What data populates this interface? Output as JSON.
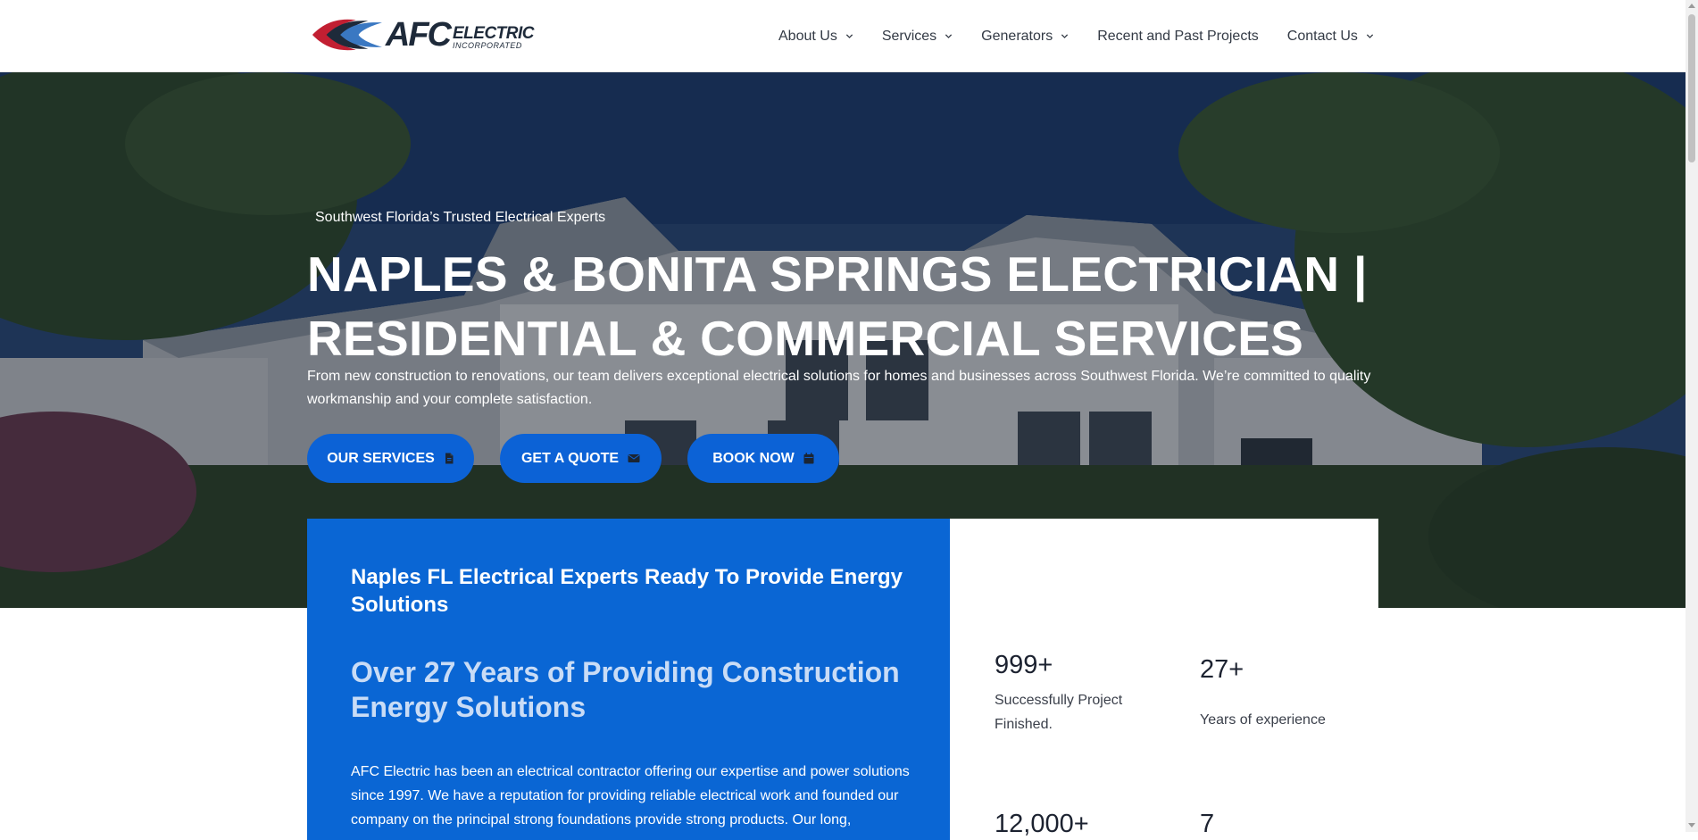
{
  "header": {
    "logo": {
      "brand": "AFC",
      "line1": "ELECTRIC",
      "line2": "INCORPORATED",
      "icon": "afc-swoosh-logo-icon",
      "colors": [
        "#c21f32",
        "#3a78c2",
        "#1e2a3a"
      ]
    },
    "nav": [
      {
        "label": "About Us",
        "has_dropdown": true
      },
      {
        "label": "Services",
        "has_dropdown": true
      },
      {
        "label": "Generators",
        "has_dropdown": true
      },
      {
        "label": "Recent and Past Projects",
        "has_dropdown": false
      },
      {
        "label": "Contact Us",
        "has_dropdown": true
      }
    ]
  },
  "hero": {
    "tagline": "Southwest Florida’s Trusted Electrical Experts",
    "title_line1": "NAPLES & BONITA SPRINGS ELECTRICIAN |",
    "title_line2": "RESIDENTIAL & COMMERCIAL SERVICES",
    "description": "From new construction to renovations, our team delivers exceptional electrical solutions for homes and businesses across Southwest Florida. We’re committed to quality workmanship and your complete satisfaction.",
    "buttons": [
      {
        "label": "OUR SERVICES",
        "icon": "document-icon"
      },
      {
        "label": "GET A QUOTE",
        "icon": "envelope-icon"
      },
      {
        "label": "BOOK NOW",
        "icon": "calendar-icon"
      }
    ],
    "accent_color": "#0c62d6"
  },
  "feature": {
    "heading": "Naples FL Electrical Experts Ready To Provide Energy Solutions",
    "subheading": "Over 27 Years of Providing Construction Energy Solutions",
    "body": "AFC Electric has been an electrical contractor offering our expertise and power solutions since 1997. We have a reputation for providing reliable electrical work and founded our company on the principal strong foundations provide strong products. Our long,",
    "panel_color": "#0a66d4"
  },
  "stats": [
    {
      "number": "999+",
      "label": "Successfully Project Finished."
    },
    {
      "number": "27+",
      "label": "Years of experience"
    },
    {
      "number": "12,000+",
      "label": ""
    },
    {
      "number": "7",
      "label": ""
    }
  ]
}
